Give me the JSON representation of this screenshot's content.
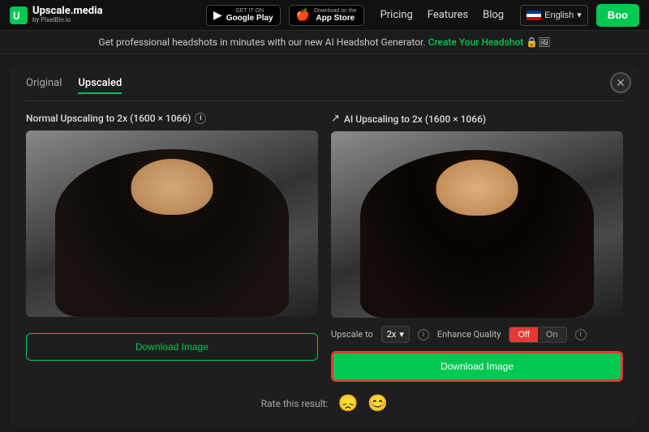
{
  "header": {
    "logo_main": "Upscale.media",
    "logo_sub": "by PixelBin.io",
    "google_play_top": "GET IT ON",
    "google_play_name": "Google Play",
    "app_store_top": "Download on the",
    "app_store_name": "App Store",
    "nav": {
      "pricing": "Pricing",
      "features": "Features",
      "blog": "Blog"
    },
    "lang": "English",
    "boost_btn": "Boo"
  },
  "banner": {
    "text": "Get professional headshots in minutes with our new AI Headshot Generator.",
    "link_text": "Create Your Headshot",
    "icons": "🔒🖼"
  },
  "tabs": [
    {
      "label": "Original",
      "active": false
    },
    {
      "label": "Upscaled",
      "active": true
    }
  ],
  "close_btn": "✕",
  "panels": [
    {
      "id": "normal",
      "title_prefix": "Normal Upscaling to 2x",
      "dimensions": "(1600 × 1066)",
      "has_ai_icon": false,
      "download_label": "Download Image",
      "download_style": "outline"
    },
    {
      "id": "ai",
      "title_prefix": "AI Upscaling to 2x",
      "dimensions": "(1600 × 1066)",
      "has_ai_icon": true,
      "download_label": "Download Image",
      "download_style": "primary"
    }
  ],
  "controls": {
    "upscale_label": "Upscale to",
    "upscale_value": "2x",
    "enhance_label": "Enhance Quality",
    "off_label": "Off",
    "on_label": "On"
  },
  "rate": {
    "label": "Rate this result:",
    "sad_emoji": "😞",
    "happy_emoji": "😊"
  }
}
